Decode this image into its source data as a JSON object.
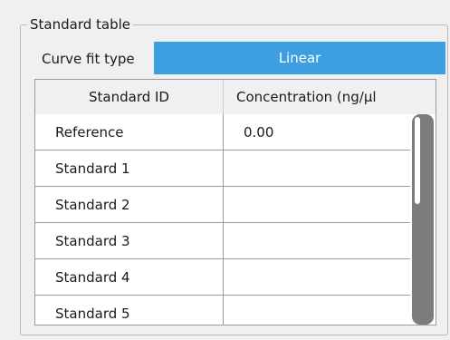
{
  "group": {
    "title": "Standard table"
  },
  "curve_fit": {
    "label": "Curve fit type",
    "value": "Linear"
  },
  "table": {
    "headers": [
      "Standard ID",
      "Concentration (ng/µl"
    ],
    "rows": [
      {
        "id": "Reference",
        "concentration": "0.00"
      },
      {
        "id": "Standard 1",
        "concentration": ""
      },
      {
        "id": "Standard 2",
        "concentration": ""
      },
      {
        "id": "Standard 3",
        "concentration": ""
      },
      {
        "id": "Standard 4",
        "concentration": ""
      },
      {
        "id": "Standard 5",
        "concentration": ""
      }
    ]
  },
  "colors": {
    "accent": "#3d9ee2",
    "panel_bg": "#f0f0f0",
    "scrollbar": "#7c7c7c"
  }
}
